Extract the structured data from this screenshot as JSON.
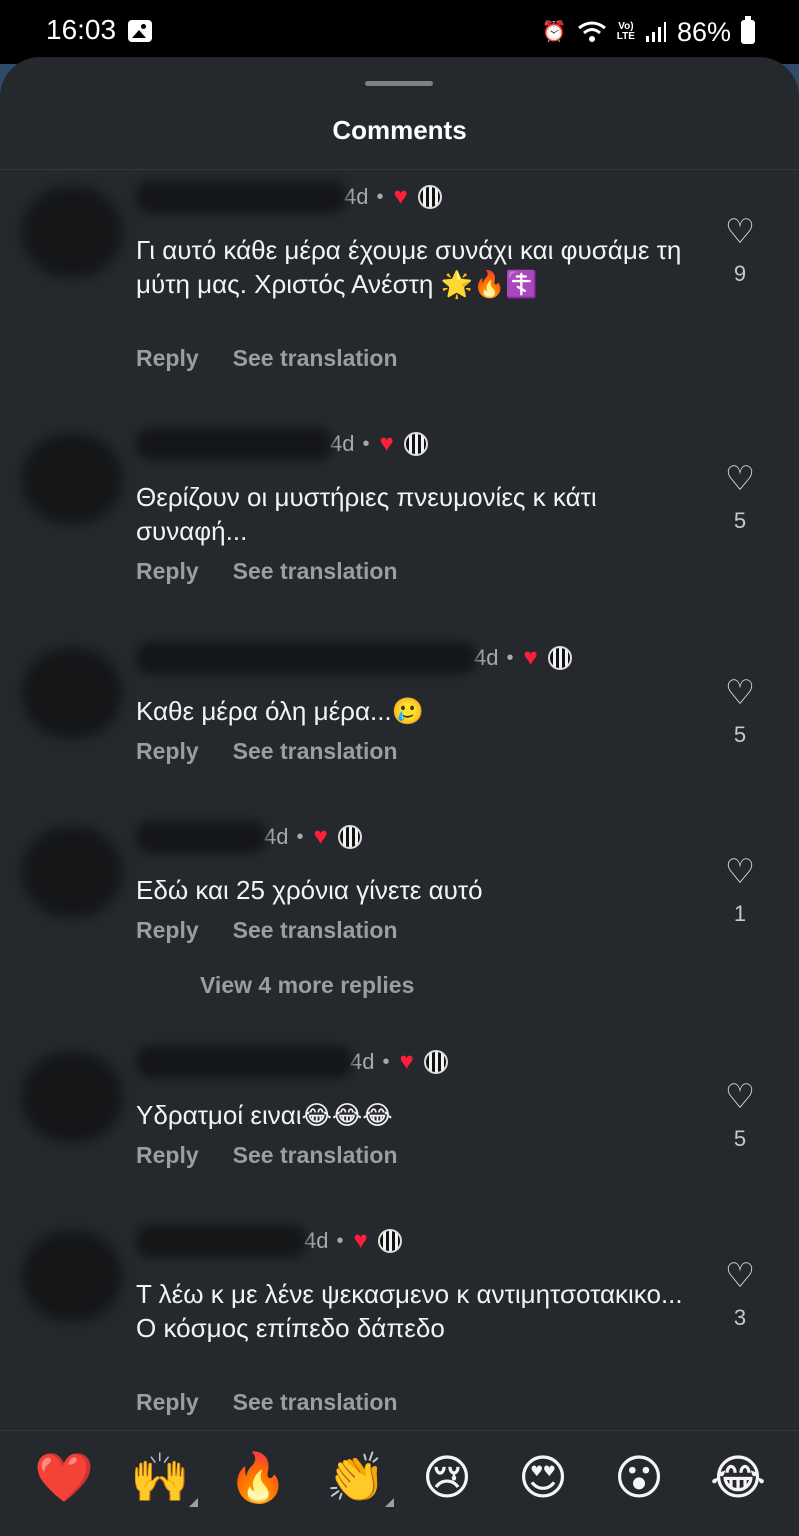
{
  "status_bar": {
    "time": "16:03",
    "battery": "86%",
    "lte_label_top": "Vo)",
    "lte_label_bottom": "LTE",
    "icons": [
      "gallery-icon",
      "alarm-icon",
      "wifi-icon",
      "lte-icon",
      "signal-icon",
      "battery-icon"
    ]
  },
  "sheet": {
    "title": "Comments"
  },
  "comments": [
    {
      "time": "4d",
      "text": "Γι αυτό  κάθε μέρα έχουμε συνάχι και φυσάμε τη μύτη μας. Χριστός Ανέστη 🌟🔥☦️",
      "likes": "9"
    },
    {
      "time": "4d",
      "text": "Θερίζουν οι μυστήριες πνευμονίες κ κάτι συναφή...",
      "likes": "5"
    },
    {
      "time": "4d",
      "text": "Καθε μέρα όλη μέρα...🥲",
      "likes": "5"
    },
    {
      "time": "4d",
      "text": "Εδώ και 25 χρόνια γίνετε αυτό",
      "likes": "1"
    },
    {
      "time": "4d",
      "text": "Υδρατμοί ειναι😂😂😂",
      "likes": "5"
    },
    {
      "time": "4d",
      "text": "Τ λέω κ με λένε ψεκασμενο κ αντιμητσοτακικο... Ο κόσμος επίπεδο δάπεδο",
      "likes": "3"
    }
  ],
  "actions": {
    "reply": "Reply",
    "see_translation": "See translation",
    "view_more": "View 4 more replies",
    "dot": "•"
  },
  "reactions": [
    "❤️",
    "🙌",
    "🔥",
    "👏",
    "😢",
    "😍",
    "😮",
    "😂"
  ],
  "colors": {
    "sheet_bg": "#25282c",
    "accent_red": "#ff1f3d",
    "secondary_text": "#9a9da2"
  }
}
